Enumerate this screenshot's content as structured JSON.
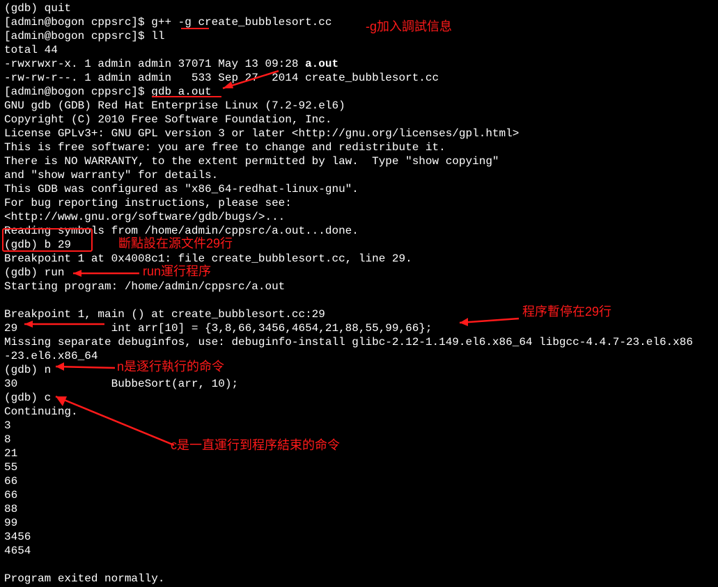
{
  "terminal": {
    "lines": [
      {
        "segments": [
          {
            "t": "(gdb) quit"
          }
        ]
      },
      {
        "segments": [
          {
            "t": "[admin@bogon cppsrc]$ g++ -g create_bubblesort.cc"
          }
        ]
      },
      {
        "segments": [
          {
            "t": "[admin@bogon cppsrc]$ ll"
          }
        ]
      },
      {
        "segments": [
          {
            "t": "total 44"
          }
        ]
      },
      {
        "segments": [
          {
            "t": "-rwxrwxr-x. 1 admin admin 37071 May 13 09:28 "
          },
          {
            "t": "a.out",
            "bold": true
          }
        ]
      },
      {
        "segments": [
          {
            "t": "-rw-rw-r--. 1 admin admin   533 Sep 27  2014 create_bubblesort.cc"
          }
        ]
      },
      {
        "segments": [
          {
            "t": "[admin@bogon cppsrc]$ gdb a.out"
          }
        ]
      },
      {
        "segments": [
          {
            "t": "GNU gdb (GDB) Red Hat Enterprise Linux (7.2-92.el6)"
          }
        ]
      },
      {
        "segments": [
          {
            "t": "Copyright (C) 2010 Free Software Foundation, Inc."
          }
        ]
      },
      {
        "segments": [
          {
            "t": "License GPLv3+: GNU GPL version 3 or later <http://gnu.org/licenses/gpl.html>"
          }
        ]
      },
      {
        "segments": [
          {
            "t": "This is free software: you are free to change and redistribute it."
          }
        ]
      },
      {
        "segments": [
          {
            "t": "There is NO WARRANTY, to the extent permitted by law.  Type \"show copying\""
          }
        ]
      },
      {
        "segments": [
          {
            "t": "and \"show warranty\" for details."
          }
        ]
      },
      {
        "segments": [
          {
            "t": "This GDB was configured as \"x86_64-redhat-linux-gnu\"."
          }
        ]
      },
      {
        "segments": [
          {
            "t": "For bug reporting instructions, please see:"
          }
        ]
      },
      {
        "segments": [
          {
            "t": "<http://www.gnu.org/software/gdb/bugs/>..."
          }
        ]
      },
      {
        "segments": [
          {
            "t": "Reading symbols from /home/admin/cppsrc/a.out...done."
          }
        ]
      },
      {
        "segments": [
          {
            "t": "(gdb) b 29"
          }
        ]
      },
      {
        "segments": [
          {
            "t": "Breakpoint 1 at 0x4008c1: file create_bubblesort.cc, line 29."
          }
        ]
      },
      {
        "segments": [
          {
            "t": "(gdb) run"
          }
        ]
      },
      {
        "segments": [
          {
            "t": "Starting program: /home/admin/cppsrc/a.out"
          }
        ]
      },
      {
        "segments": [
          {
            "t": " "
          }
        ]
      },
      {
        "segments": [
          {
            "t": "Breakpoint 1, main () at create_bubblesort.cc:29"
          }
        ]
      },
      {
        "segments": [
          {
            "t": "29              int arr[10] = {3,8,66,3456,4654,21,88,55,99,66};"
          }
        ]
      },
      {
        "segments": [
          {
            "t": "Missing separate debuginfos, use: debuginfo-install glibc-2.12-1.149.el6.x86_64 libgcc-4.4.7-23.el6.x86"
          }
        ]
      },
      {
        "segments": [
          {
            "t": "-23.el6.x86_64"
          }
        ]
      },
      {
        "segments": [
          {
            "t": "(gdb) n"
          }
        ]
      },
      {
        "segments": [
          {
            "t": "30              BubbeSort(arr, 10);"
          }
        ]
      },
      {
        "segments": [
          {
            "t": "(gdb) c"
          }
        ]
      },
      {
        "segments": [
          {
            "t": "Continuing."
          }
        ]
      },
      {
        "segments": [
          {
            "t": "3"
          }
        ]
      },
      {
        "segments": [
          {
            "t": "8"
          }
        ]
      },
      {
        "segments": [
          {
            "t": "21"
          }
        ]
      },
      {
        "segments": [
          {
            "t": "55"
          }
        ]
      },
      {
        "segments": [
          {
            "t": "66"
          }
        ]
      },
      {
        "segments": [
          {
            "t": "66"
          }
        ]
      },
      {
        "segments": [
          {
            "t": "88"
          }
        ]
      },
      {
        "segments": [
          {
            "t": "99"
          }
        ]
      },
      {
        "segments": [
          {
            "t": "3456"
          }
        ]
      },
      {
        "segments": [
          {
            "t": "4654"
          }
        ]
      },
      {
        "segments": [
          {
            "t": " "
          }
        ]
      },
      {
        "segments": [
          {
            "t": "Program exited normally."
          }
        ]
      }
    ]
  },
  "annotations": {
    "g_flag": "-g加入調試信息",
    "breakpoint29": "斷點設在源文件29行",
    "run_prog": "run運行程序",
    "pause29": "程序暫停在29行",
    "n_cmd": "n是逐行執行的命令",
    "c_cmd": "c是一直運行到程序結束的命令"
  }
}
